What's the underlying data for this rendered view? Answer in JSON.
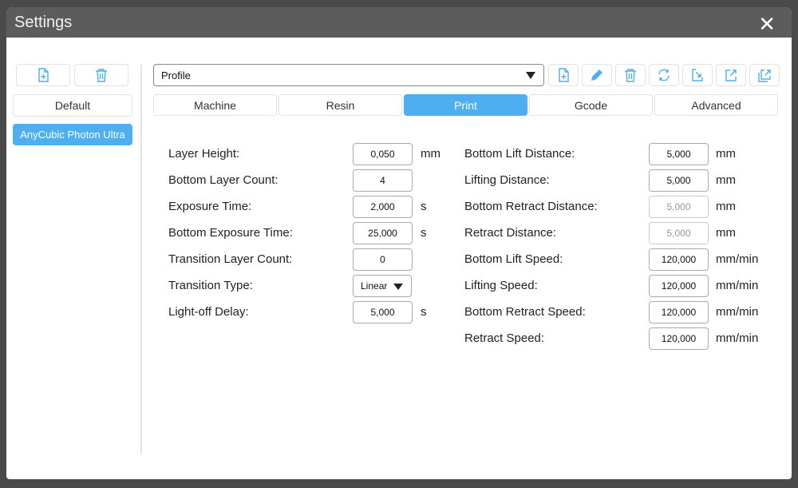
{
  "window": {
    "title": "Settings",
    "close_icon": "close-icon"
  },
  "sidebar": {
    "profiles": [
      "Default",
      "AnyCubic Photon Ultra"
    ],
    "selected": "AnyCubic Photon Ultra"
  },
  "profile_dropdown": {
    "value": "Profile"
  },
  "toolbar": [
    "new-file-icon",
    "pencil-icon",
    "trash-icon",
    "refresh-icon",
    "import-icon",
    "export-icon",
    "export-all-icon"
  ],
  "tabs": [
    {
      "label": "Machine"
    },
    {
      "label": "Resin"
    },
    {
      "label": "Print",
      "active": true
    },
    {
      "label": "Gcode"
    },
    {
      "label": "Advanced"
    }
  ],
  "left_fields": [
    {
      "label": "Layer Height:",
      "value": "0,050",
      "unit": "mm"
    },
    {
      "label": "Bottom Layer Count:",
      "value": "4",
      "unit": ""
    },
    {
      "label": "Exposure Time:",
      "value": "2,000",
      "unit": "s"
    },
    {
      "label": "Bottom Exposure Time:",
      "value": "25,000",
      "unit": "s"
    },
    {
      "label": "Transition Layer Count:",
      "value": "0",
      "unit": ""
    },
    {
      "label": "Transition Type:",
      "value": "Linear",
      "unit": ""
    },
    {
      "label": "Light-off Delay:",
      "value": "5,000",
      "unit": "s"
    }
  ],
  "right_fields": [
    {
      "label": "Bottom Lift Distance:",
      "value": "5,000",
      "unit": "mm"
    },
    {
      "label": "Lifting Distance:",
      "value": "5,000",
      "unit": "mm"
    },
    {
      "label": "Bottom Retract Distance:",
      "value": "5,000",
      "unit": "mm",
      "disabled": true
    },
    {
      "label": "Retract Distance:",
      "value": "5,000",
      "unit": "mm",
      "disabled": true
    },
    {
      "label": "Bottom Lift Speed:",
      "value": "120,000",
      "unit": "mm/min"
    },
    {
      "label": "Lifting Speed:",
      "value": "120,000",
      "unit": "mm/min"
    },
    {
      "label": "Bottom Retract Speed:",
      "value": "120,000",
      "unit": "mm/min"
    },
    {
      "label": "Retract Speed:",
      "value": "120,000",
      "unit": "mm/min"
    }
  ],
  "colors": {
    "accent": "#4daef0",
    "titlebar": "#5c5c5c"
  }
}
